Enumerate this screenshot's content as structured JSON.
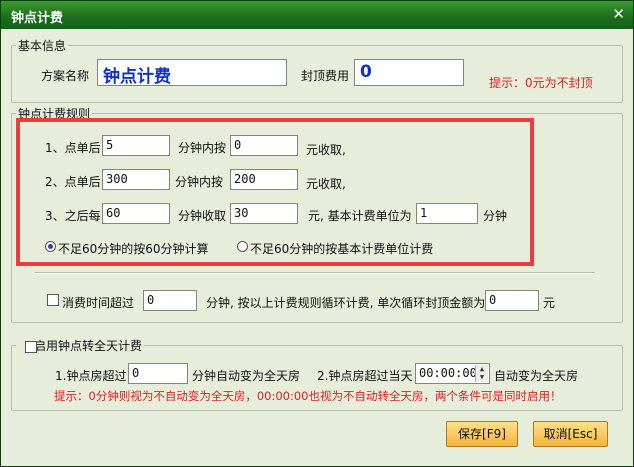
{
  "window": {
    "title": "钟点计费",
    "close_glyph": "✕"
  },
  "basic": {
    "legend": "基本信息",
    "scheme_label": "方案名称",
    "scheme_value": "钟点计费",
    "cap_label": "封顶费用",
    "cap_value": "0",
    "hint": "提示：0元为不封顶"
  },
  "rules": {
    "legend": "钟点计费规则",
    "rows": [
      {
        "prefix": "1、点单后",
        "input1": "5",
        "mid": "分钟内按",
        "input2": "0",
        "suffix": "元收取,"
      },
      {
        "prefix": "2、点单后",
        "input1": "300",
        "mid": "分钟内按",
        "input2": "200",
        "suffix": "元收取,"
      },
      {
        "prefix": "3、之后每",
        "input1": "60",
        "mid": "分钟收取",
        "input2": "30",
        "suffix": "元, 基本计费单位为",
        "input3": "1",
        "suffix2": "分钟"
      }
    ],
    "radio_a": "不足60分钟的按60分钟计算",
    "radio_b": "不足60分钟的按基本计费单位计费"
  },
  "cycle": {
    "label1": "消费时间超过",
    "input1": "0",
    "label2": "分钟, 按以上计费规则循环计费, 单次循环封顶金额为",
    "input2": "0",
    "label3": "元"
  },
  "fullday": {
    "legend": "启用钟点转全天计费",
    "label1": "1.钟点房超过",
    "input1": "0",
    "label2": "分钟自动变为全天房",
    "label3": "2.钟点房超过当天",
    "time_value": "00:00:00",
    "label4": "自动变为全天房",
    "note": "提示：0分钟则视为不自动变为全天房，00:00:00也视为不自动转全天房，两个条件可是同时启用！"
  },
  "buttons": {
    "save": "保存[F9]",
    "cancel": "取消[Esc]"
  },
  "colors": {
    "title_bar": "#1c6e1c",
    "background": "#e6eddb",
    "highlight_box": "#ee3b3b",
    "hint_red": "#e02020",
    "name_blue": "#1030c8",
    "button": "#f5b53c"
  }
}
